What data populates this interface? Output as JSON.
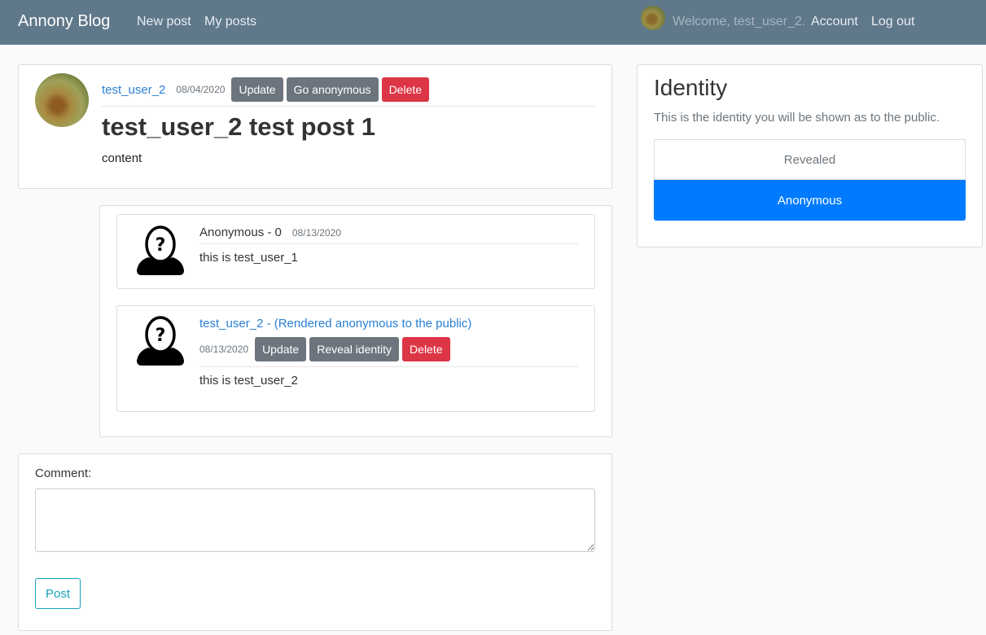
{
  "navbar": {
    "brand": "Annony Blog",
    "links": [
      "New post",
      "My posts"
    ],
    "welcome": "Welcome, test_user_2.",
    "account": "Account",
    "logout": "Log out"
  },
  "post": {
    "author": "test_user_2",
    "date": "08/04/2020",
    "buttons": {
      "update": "Update",
      "anonymous": "Go anonymous",
      "delete": "Delete"
    },
    "title": "test_user_2 test post 1",
    "content": "content"
  },
  "comments": [
    {
      "author": "Anonymous - 0",
      "date": "08/13/2020",
      "text": "this is test_user_1"
    },
    {
      "author": "test_user_2 - (Rendered anonymous to the public)",
      "date": "08/13/2020",
      "buttons": {
        "update": "Update",
        "reveal": "Reveal identity",
        "delete": "Delete"
      },
      "text": "this is test_user_2"
    }
  ],
  "comment_form": {
    "label": "Comment:",
    "value": "",
    "submit": "Post"
  },
  "identity": {
    "title": "Identity",
    "subtitle": "This is the identity you will be shown as to the public.",
    "options": [
      "Revealed",
      "Anonymous"
    ],
    "selected": "Anonymous"
  },
  "colors": {
    "navbar": "#5f788a",
    "link": "#2a7fd4",
    "primary": "#007bff",
    "danger": "#dc3545",
    "secondary": "#6c757d",
    "info": "#17a2b8"
  }
}
